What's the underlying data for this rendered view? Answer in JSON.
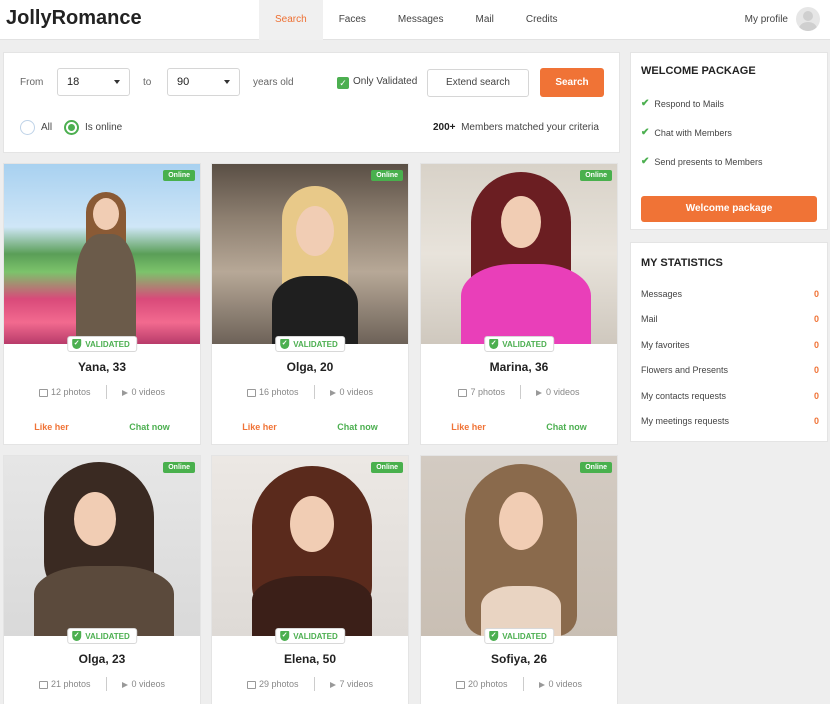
{
  "app": {
    "logo": "JollyRomance"
  },
  "nav": [
    {
      "label": "Search",
      "active": true
    },
    {
      "label": "Faces"
    },
    {
      "label": "Messages"
    },
    {
      "label": "Mail"
    },
    {
      "label": "Credits"
    }
  ],
  "profile": {
    "label": "My profile"
  },
  "filter": {
    "from_label": "From",
    "from_value": "18",
    "to_label": "to",
    "to_value": "90",
    "years_label": "years old",
    "only_validated_label": "Only Validated",
    "only_validated_checked": true,
    "extend_label": "Extend search",
    "search_label": "Search",
    "radio_all": "All",
    "radio_online": "Is online",
    "selected_radio": "Is online",
    "matched_count": "200+",
    "matched_text": "Members matched your criteria"
  },
  "card_labels": {
    "online": "Online",
    "validated": "VALIDATED",
    "like": "Like her",
    "chat": "Chat now"
  },
  "members": [
    {
      "name": "Yana, 33",
      "photos": "12 photos",
      "videos": "0 videos"
    },
    {
      "name": "Olga, 20",
      "photos": "16 photos",
      "videos": "0 videos"
    },
    {
      "name": "Marina, 36",
      "photos": "7 photos",
      "videos": "0 videos"
    },
    {
      "name": "Olga, 23",
      "photos": "21 photos",
      "videos": "0 videos"
    },
    {
      "name": "Elena, 50",
      "photos": "29 photos",
      "videos": "7 videos"
    },
    {
      "name": "Sofiya, 26",
      "photos": "20 photos",
      "videos": "0 videos"
    }
  ],
  "welcome": {
    "title": "WELCOME PACKAGE",
    "items": [
      "Respond to Mails",
      "Chat with Members",
      "Send presents to Members"
    ],
    "button": "Welcome package"
  },
  "stats": {
    "title": "MY STATISTICS",
    "items": [
      {
        "label": "Messages",
        "value": "0"
      },
      {
        "label": "Mail",
        "value": "0"
      },
      {
        "label": "My favorites",
        "value": "0"
      },
      {
        "label": "Flowers and Presents",
        "value": "0"
      },
      {
        "label": "My contacts requests",
        "value": "0"
      },
      {
        "label": "My meetings requests",
        "value": "0"
      }
    ]
  },
  "colors": {
    "accent": "#f07336",
    "green": "#4caf50",
    "background": "#eeeeee"
  }
}
